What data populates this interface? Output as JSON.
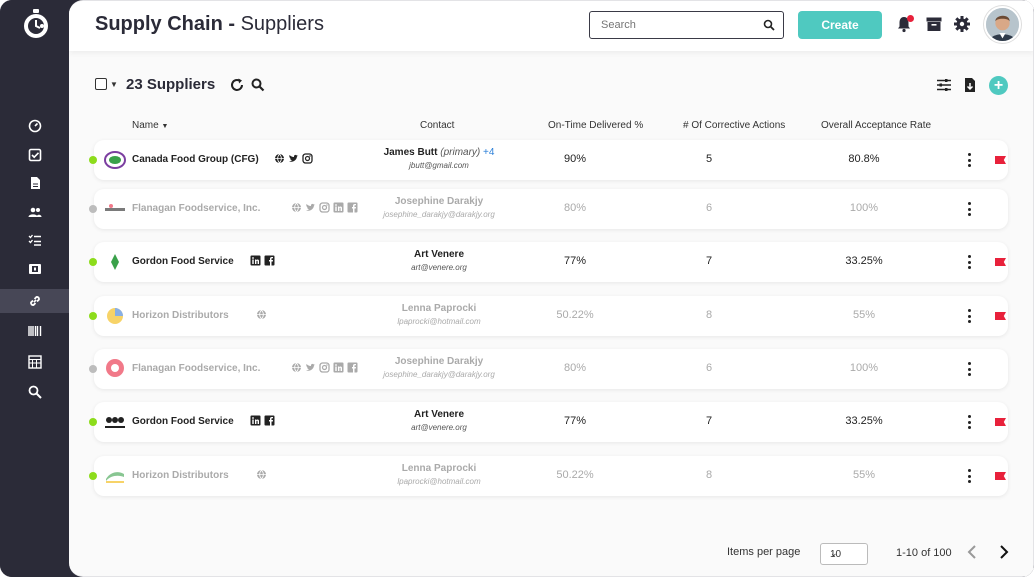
{
  "header": {
    "title_bold": "Supply Chain - ",
    "title_rest": "Suppliers",
    "search_placeholder": "Search",
    "create_label": "Create"
  },
  "toolbar": {
    "count_title": "23 Suppliers"
  },
  "columns": {
    "name": "Name",
    "contact": "Contact",
    "on_time": "On-Time Delivered %",
    "corrective": "# Of Corrective Actions",
    "acceptance": "Overall Acceptance Rate"
  },
  "rows": [
    {
      "name": "Canada Food Group (CFG)",
      "contact": "James Butt",
      "primary": "(primary)",
      "more": "+4",
      "email": "jbutt@gmail.com",
      "on_time": "90%",
      "corrective": "5",
      "acceptance": "80.8%",
      "status": "green",
      "muted": false,
      "flag": true,
      "social": [
        "globe",
        "twitter",
        "instagram"
      ]
    },
    {
      "name": "Flanagan Foodservice, Inc.",
      "contact": "Josephine Darakjy",
      "primary": "",
      "more": "",
      "email": "josephine_darakjy@darakjy.org",
      "on_time": "80%",
      "corrective": "6",
      "acceptance": "100%",
      "status": "grey",
      "muted": true,
      "flag": false,
      "social": [
        "globe",
        "twitter",
        "instagram",
        "linkedin",
        "facebook"
      ]
    },
    {
      "name": "Gordon Food Service",
      "contact": "Art Venere",
      "primary": "",
      "more": "",
      "email": "art@venere.org",
      "on_time": "77%",
      "corrective": "7",
      "acceptance": "33.25%",
      "status": "green",
      "muted": false,
      "flag": true,
      "social": [
        "linkedin",
        "facebook"
      ]
    },
    {
      "name": "Horizon Distributors",
      "contact": "Lenna Paprocki",
      "primary": "",
      "more": "",
      "email": "lpaprocki@hotmail.com",
      "on_time": "50.22%",
      "corrective": "8",
      "acceptance": "55%",
      "status": "green",
      "muted": true,
      "flag": true,
      "social": [
        "globe"
      ]
    },
    {
      "name": "Flanagan Foodservice, Inc.",
      "contact": "Josephine Darakjy",
      "primary": "",
      "more": "",
      "email": "josephine_darakjy@darakjy.org",
      "on_time": "80%",
      "corrective": "6",
      "acceptance": "100%",
      "status": "grey",
      "muted": true,
      "flag": false,
      "social": [
        "globe",
        "twitter",
        "instagram",
        "linkedin",
        "facebook"
      ]
    },
    {
      "name": "Gordon Food Service",
      "contact": "Art Venere",
      "primary": "",
      "more": "",
      "email": "art@venere.org",
      "on_time": "77%",
      "corrective": "7",
      "acceptance": "33.25%",
      "status": "green",
      "muted": false,
      "flag": true,
      "social": [
        "linkedin",
        "facebook"
      ]
    },
    {
      "name": "Horizon Distributors",
      "contact": "Lenna Paprocki",
      "primary": "",
      "more": "",
      "email": "lpaprocki@hotmail.com",
      "on_time": "50.22%",
      "corrective": "8",
      "acceptance": "55%",
      "status": "green",
      "muted": true,
      "flag": true,
      "social": [
        "globe"
      ]
    }
  ],
  "pagination": {
    "items_label": "Items per page",
    "per_page": "10",
    "range": "1-10 of 100"
  },
  "colors": {
    "sidebar": "#2b2b38",
    "accent": "#4fc9c0",
    "status_active": "#8ddc1c",
    "status_inactive": "#bdbdbd",
    "flag": "#e8213b",
    "link": "#2c80d8"
  },
  "icons": {
    "sidebar": [
      "dashboard-icon",
      "checkbox-icon",
      "document-icon",
      "users-icon",
      "checklist-icon",
      "inventory-icon",
      "link-icon",
      "barcode-icon",
      "calendar-grid-icon",
      "search-icon"
    ],
    "header": [
      "search-icon",
      "bell-icon",
      "archive-icon",
      "gear-icon"
    ],
    "toolbar": [
      "refresh-icon",
      "search-icon",
      "filter-sliders-icon",
      "download-file-icon",
      "add-circle-icon"
    ]
  }
}
